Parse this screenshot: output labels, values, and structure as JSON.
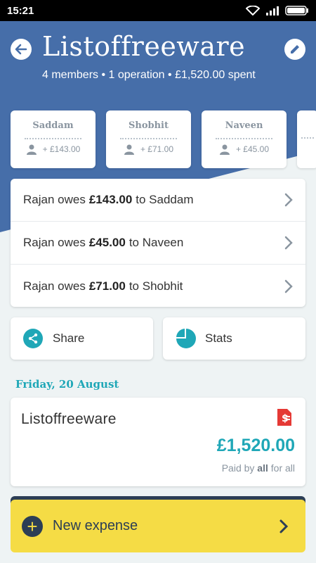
{
  "status_bar": {
    "time": "15:21"
  },
  "header": {
    "title": "Listoffreeware",
    "subtitle": "4 members • 1 operation • £1,520.00 spent"
  },
  "members": [
    {
      "name": "Saddam",
      "balance": "+ £143.00"
    },
    {
      "name": "Shobhit",
      "balance": "+ £71.00"
    },
    {
      "name": "Naveen",
      "balance": "+ £45.00"
    }
  ],
  "debts": [
    {
      "prefix": "Rajan owes",
      "amount": "£143.00",
      "suffix": "to Saddam"
    },
    {
      "prefix": "Rajan owes",
      "amount": "£45.00",
      "suffix": "to Naveen"
    },
    {
      "prefix": "Rajan owes",
      "amount": "£71.00",
      "suffix": "to Shobhit"
    }
  ],
  "actions": {
    "share_label": "Share",
    "stats_label": "Stats"
  },
  "expense_section": {
    "date": "Friday, 20 August",
    "expense": {
      "title": "Listoffreeware",
      "amount": "£1,520.00",
      "paid_by_prefix": "Paid by",
      "paid_by_who": "all",
      "paid_by_suffix": "for all"
    }
  },
  "new_expense_label": "New expense",
  "colors": {
    "header": "#466ea9",
    "accent": "#1fa7b7",
    "new_expense_bg": "#f5dc45",
    "dark": "#2c3e55",
    "receipt": "#e53935"
  }
}
